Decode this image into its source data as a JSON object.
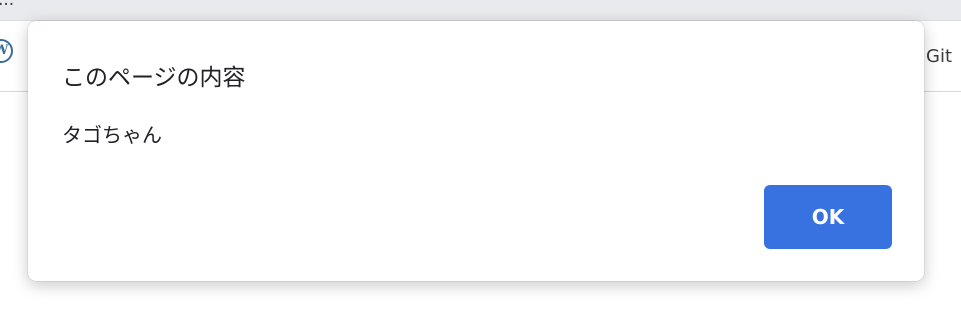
{
  "browser": {
    "title_fragment": "...",
    "bookmarks": {
      "left_icon_letter": "W",
      "right_label": "Git"
    }
  },
  "dialog": {
    "title": "このページの内容",
    "message": "タゴちゃん",
    "ok_label": "OK",
    "accent_color": "#3871e0"
  }
}
